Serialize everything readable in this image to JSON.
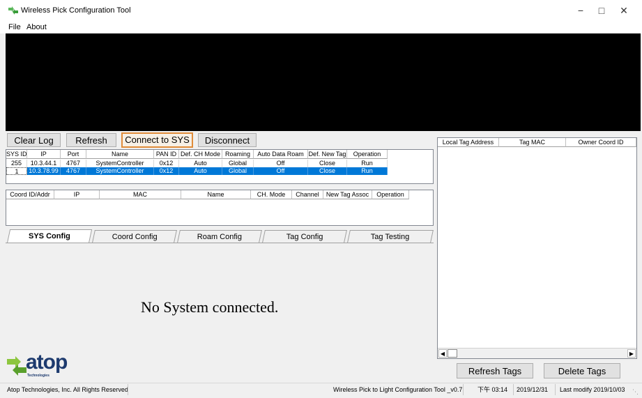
{
  "window": {
    "title": "Wireless Pick Configuration Tool",
    "minimize": "−",
    "maximize": "□",
    "close": "✕",
    "icon": "green-arrows-icon"
  },
  "menu": {
    "file": "File",
    "about": "About"
  },
  "toolbar": {
    "clear_log": "Clear Log",
    "refresh": "Refresh",
    "connect": "Connect to SYS",
    "disconnect": "Disconnect"
  },
  "sys_table": {
    "headers": [
      "SYS ID",
      "IP",
      "Port",
      "Name",
      "PAN ID",
      "Def. CH Mode",
      "Roaming",
      "Auto Data Roam",
      "Def. New Tag",
      "Operation"
    ],
    "rows": [
      [
        "255",
        "10.3.44.1",
        "4767",
        "SystemController",
        "0x12",
        "Auto",
        "Global",
        "Off",
        "Close",
        "Run"
      ],
      [
        "1",
        "10.3.78.99",
        "4767",
        "SystemController",
        "0x12",
        "Auto",
        "Global",
        "Off",
        "Close",
        "Run"
      ]
    ],
    "selected_row": 1
  },
  "coord_table": {
    "headers": [
      "Coord ID/Addr",
      "IP",
      "MAC",
      "Name",
      "CH. Mode",
      "Channel",
      "New Tag Assoc",
      "Operation"
    ]
  },
  "tabs": [
    "SYS Config",
    "Coord Config",
    "Roam Config",
    "Tag Config",
    "Tag Testing"
  ],
  "active_tab": "SYS Config",
  "panel_message": "No System connected.",
  "logo": {
    "name": "atop",
    "sub": "Technologies"
  },
  "tag_table": {
    "headers": [
      "Local Tag Address",
      "Tag MAC",
      "Owner Coord ID"
    ]
  },
  "tag_buttons": {
    "refresh": "Refresh Tags",
    "delete": "Delete Tags"
  },
  "status": {
    "copyright": "Atop Technologies, Inc. All Rights Reserved",
    "version": "Wireless Pick to Light Configuration Tool _v0.7",
    "time": "下午 03:14",
    "date": "2019/12/31",
    "last_modify": "Last modify  2019/10/03"
  },
  "colors": {
    "selection": "#0078d7",
    "logo_green": "#8dc63f",
    "logo_navy": "#1d3a6e"
  }
}
